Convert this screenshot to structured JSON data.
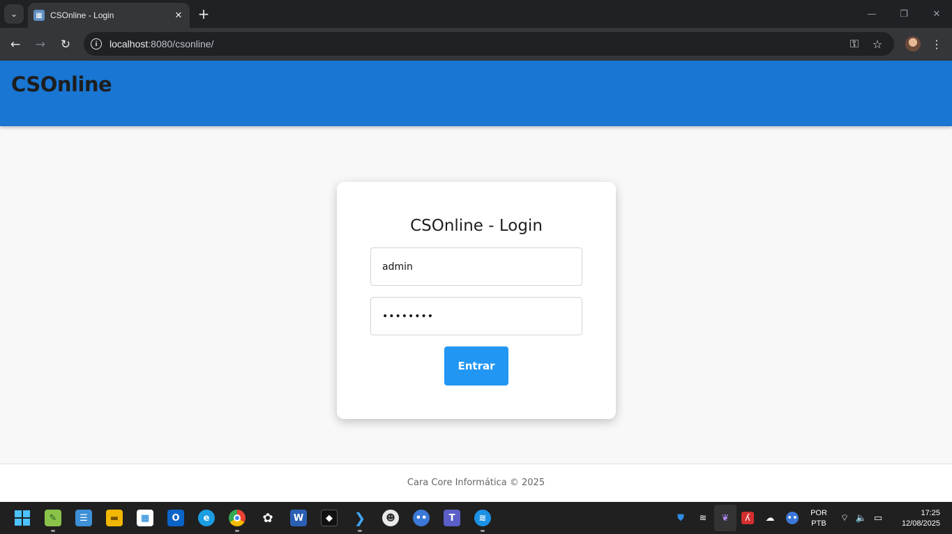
{
  "browser": {
    "tab_title": "CSOnline - Login",
    "url_host": "localhost",
    "url_rest": ":8080/csonline/"
  },
  "app": {
    "title": "CSOnline"
  },
  "login": {
    "title": "CSOnline - Login",
    "username_value": "admin",
    "password_mask": "••••••••",
    "submit_label": "Entrar"
  },
  "footer": {
    "text": "Cara Core Informática © 2025"
  },
  "taskbar": {
    "language_line1": "POR",
    "language_line2": "PTB",
    "time": "17:25",
    "date": "12/08/2025",
    "apps": [
      "start-icon",
      "notepad-plus-icon",
      "notepad-icon",
      "file-explorer-icon",
      "microsoft-store-icon",
      "outlook-icon",
      "edge-icon",
      "chrome-icon",
      "chatgpt-icon",
      "word-icon",
      "cube-app-icon",
      "vscode-icon",
      "eclipse-icon",
      "dots-app-icon",
      "teams-icon",
      "docker-icon"
    ]
  },
  "colors": {
    "header_blue": "#1976d2",
    "button_blue": "#2196f3"
  }
}
